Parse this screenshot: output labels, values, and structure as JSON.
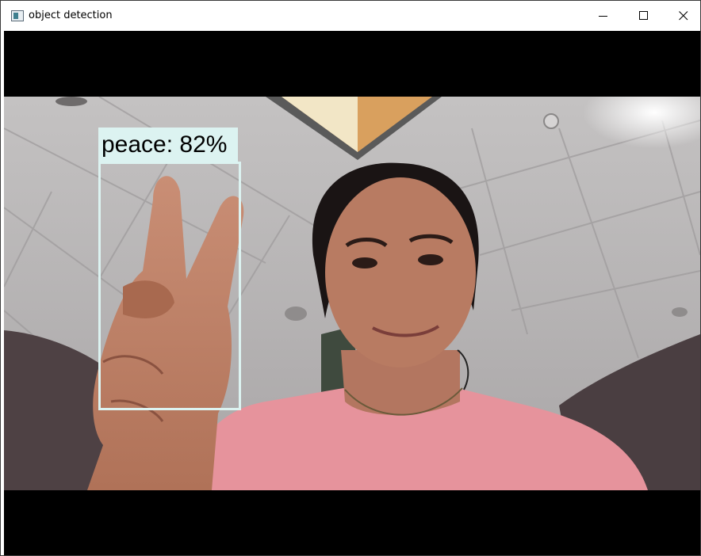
{
  "window": {
    "title": "object detection",
    "icon": "window-app-icon",
    "controls": {
      "minimize_icon": "minimize-icon",
      "maximize_icon": "maximize-icon",
      "close_icon": "close-icon"
    }
  },
  "detection": {
    "label": "peace: 82%",
    "class_name": "peace",
    "confidence_percent": 82,
    "box_color": "#dcf3f1"
  },
  "colors": {
    "letterbox": "#000000",
    "shirt": "#e8939e",
    "ceiling": "#b7b5b5"
  }
}
